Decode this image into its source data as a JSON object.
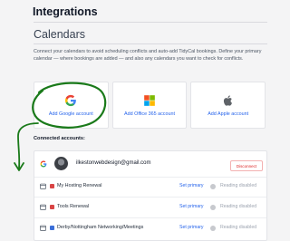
{
  "page": {
    "title": "Integrations"
  },
  "calendars": {
    "heading": "Calendars",
    "description": "Connect your calendars to avoid scheduling conflicts and auto-add TidyCal bookings. Define your primary calendar — where bookings are added — and also any calendars you want to check for conflicts."
  },
  "providers": [
    {
      "label": "Add Google account",
      "icon": "google-icon"
    },
    {
      "label": "Add Office 365 account",
      "icon": "office-365-icon"
    },
    {
      "label": "Add Apple account",
      "icon": "apple-icon"
    }
  ],
  "connected": {
    "heading": "Connected accounts:",
    "account": {
      "email": "ilkestonwebdesign@gmail.com",
      "disconnect_label": "Disconnect"
    },
    "calendars": [
      {
        "name": "My Hosting Renewal",
        "color": "#d94545",
        "set_primary_label": "Set primary",
        "status": "Reading disabled"
      },
      {
        "name": "Tools Renewal",
        "color": "#d94545",
        "set_primary_label": "Set primary",
        "status": "Reading disabled"
      },
      {
        "name": "Derby/Nottingham Networking/Meetings",
        "color": "#3b6fd8",
        "set_primary_label": "Set primary",
        "status": "Reading disabled"
      }
    ]
  },
  "annotations": {
    "color": "#1a7a1a"
  }
}
